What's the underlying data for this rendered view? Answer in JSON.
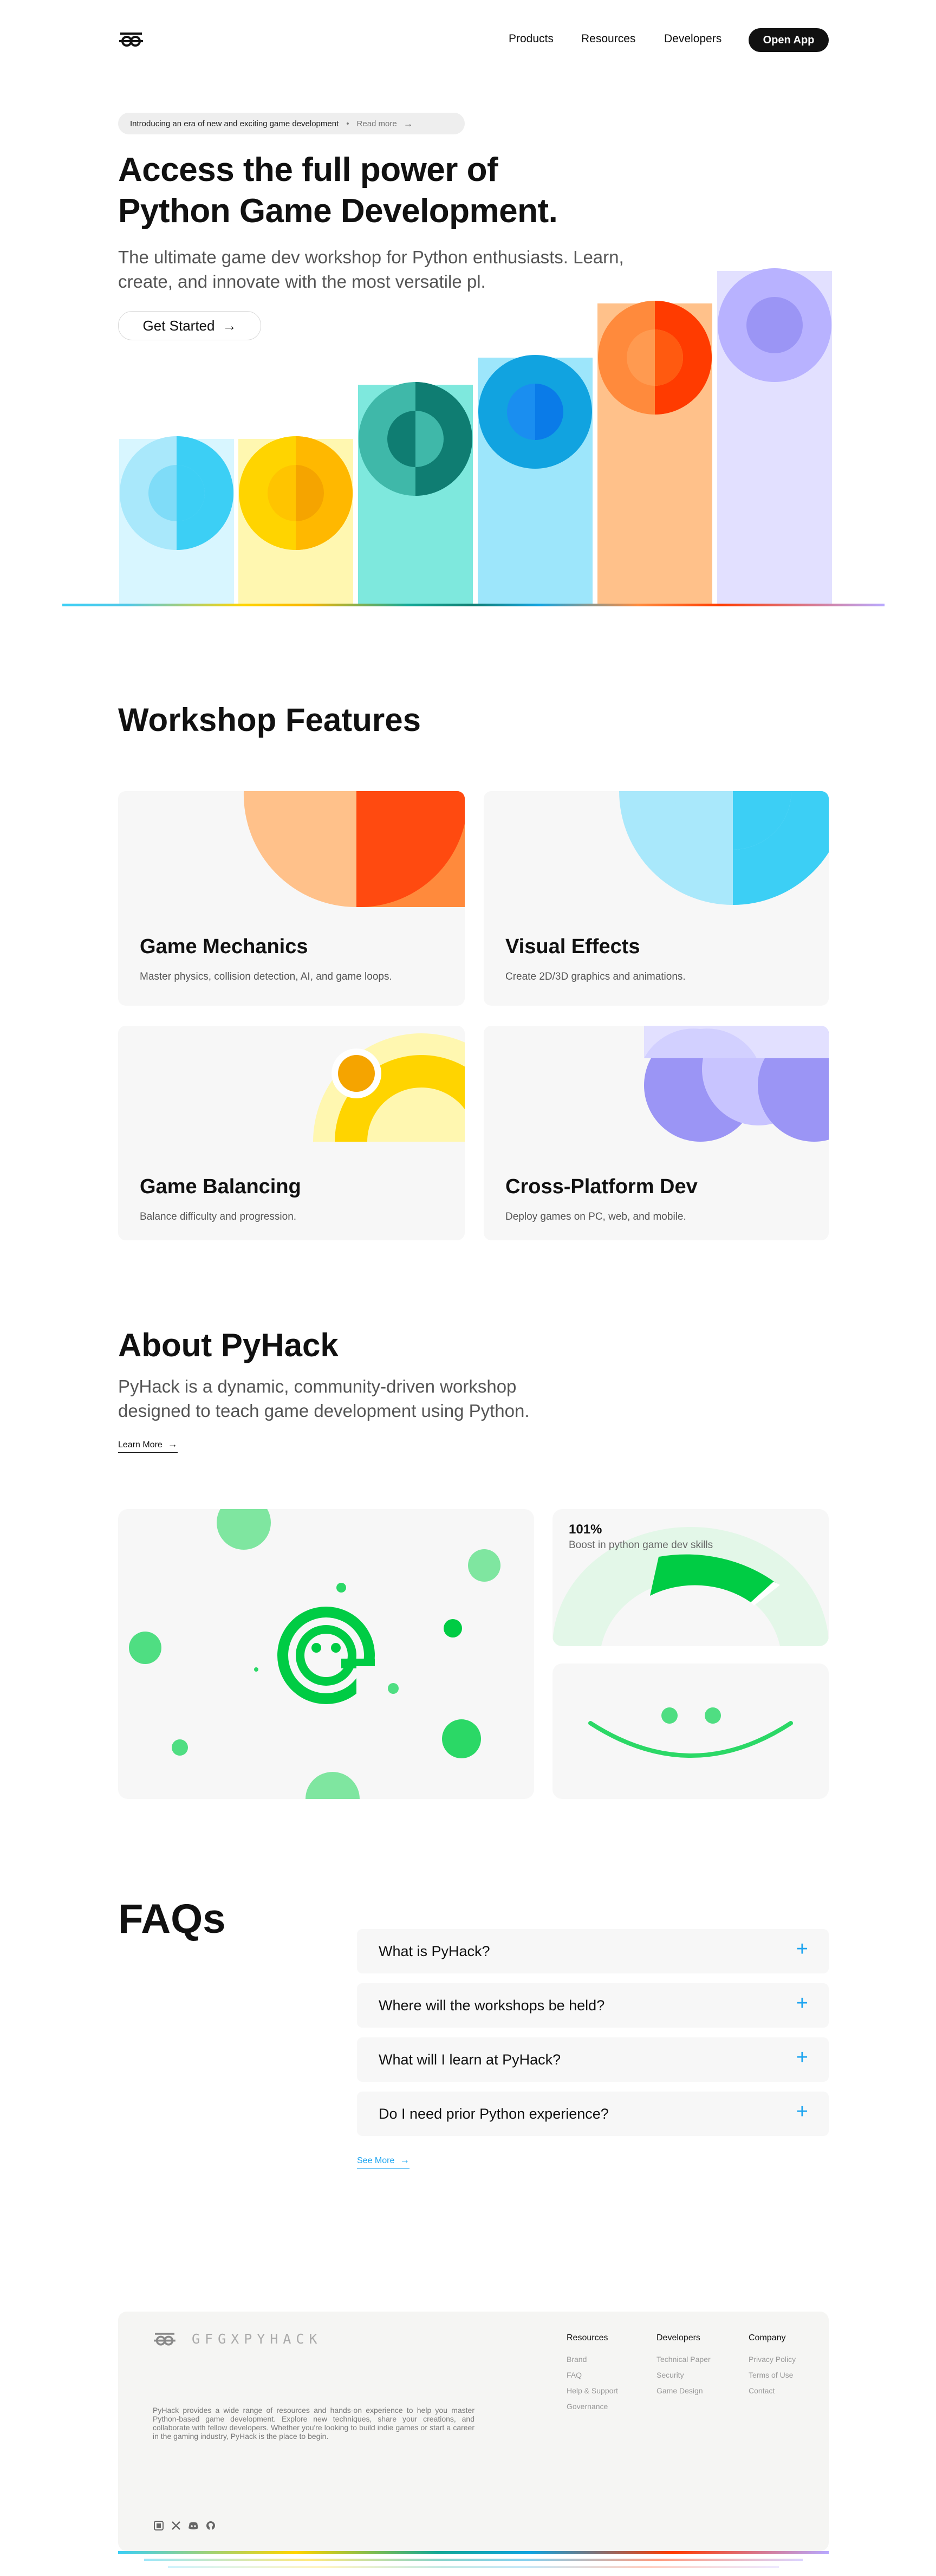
{
  "nav": {
    "links": [
      "Products",
      "Resources",
      "Developers"
    ],
    "cta": "Open App"
  },
  "hero": {
    "pill_text": "Introducing an era of new and exciting game development",
    "pill_dot": "•",
    "pill_link": "Read more",
    "title": "Access the full power of Python Game Development.",
    "subtitle": "The ultimate game dev workshop for Python enthusiasts. Learn, create, and innovate with the most versatile pl.",
    "cta": "Get Started"
  },
  "features": {
    "title": "Workshop Features",
    "cards": [
      {
        "title": "Game Mechanics",
        "desc": "Master physics, collision detection, AI, and game loops."
      },
      {
        "title": "Visual Effects",
        "desc": "Create 2D/3D graphics and animations."
      },
      {
        "title": "Game Balancing",
        "desc": "Balance difficulty and progression."
      },
      {
        "title": "Cross-Platform Dev",
        "desc": "Deploy games on PC, web, and mobile."
      }
    ]
  },
  "about": {
    "title": "About PyHack",
    "subtitle": "PyHack is a dynamic, community-driven workshop designed to teach game development using Python.",
    "link": "Learn More",
    "stat_value": "101%",
    "stat_label": "Boost in python game dev skills"
  },
  "faq": {
    "title": "FAQs",
    "items": [
      "What is PyHack?",
      "Where will the workshops be held?",
      "What will I learn at PyHack?",
      "Do I need prior Python experience?"
    ],
    "plus": "+",
    "see_more": "See More"
  },
  "footer": {
    "brand": "GFGXPYHACK",
    "description": "PyHack provides a wide range of resources and hands-on experience to help you master Python-based game development. Explore new techniques, share your creations, and collaborate with fellow developers. Whether you're looking to build indie games or start a career in the gaming industry, PyHack is the place to begin.",
    "columns": [
      {
        "title": "Resources",
        "links": [
          "Brand",
          "FAQ",
          "Help & Support",
          "Governance"
        ]
      },
      {
        "title": "Developers",
        "links": [
          "Technical Paper",
          "Security",
          "Game Design"
        ]
      },
      {
        "title": "Company",
        "links": [
          "Privacy Policy",
          "Terms of Use",
          "Contact"
        ]
      }
    ],
    "social": [
      "gfg-icon",
      "x-icon",
      "discord-icon",
      "github-icon"
    ]
  },
  "colors": {
    "accent_blue": "#1ea5f0",
    "green": "#00cc44",
    "dark": "#111111"
  }
}
